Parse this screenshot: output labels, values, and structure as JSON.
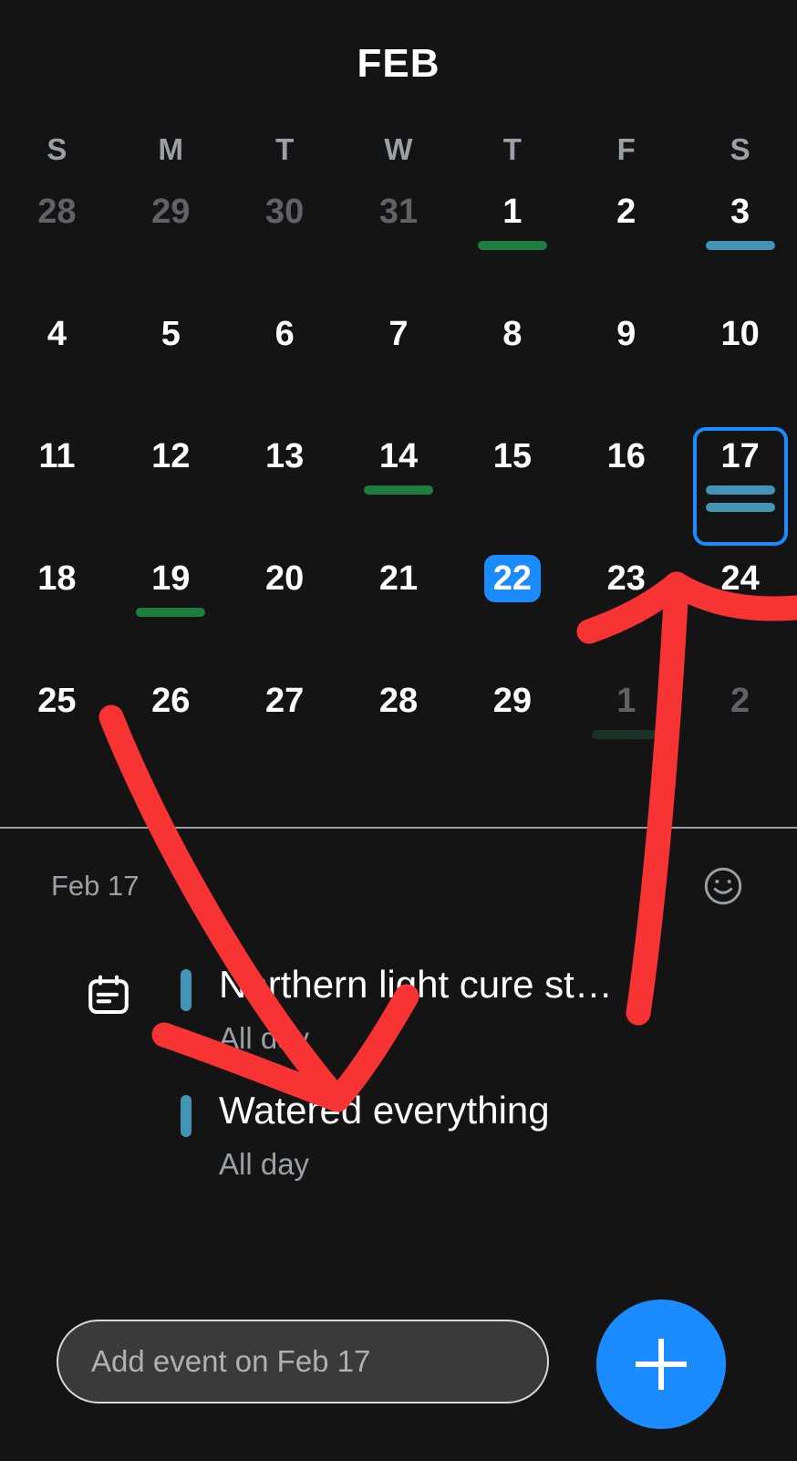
{
  "header": {
    "month_label": "FEB"
  },
  "weekdays": [
    "S",
    "M",
    "T",
    "W",
    "T",
    "F",
    "S"
  ],
  "calendar": {
    "weeks": [
      [
        {
          "num": "28",
          "other": true,
          "markers": []
        },
        {
          "num": "29",
          "other": true,
          "markers": []
        },
        {
          "num": "30",
          "other": true,
          "markers": []
        },
        {
          "num": "31",
          "other": true,
          "markers": []
        },
        {
          "num": "1",
          "other": false,
          "markers": [
            "green"
          ]
        },
        {
          "num": "2",
          "other": false,
          "markers": []
        },
        {
          "num": "3",
          "other": false,
          "markers": [
            "blue"
          ]
        }
      ],
      [
        {
          "num": "4",
          "other": false,
          "markers": []
        },
        {
          "num": "5",
          "other": false,
          "markers": []
        },
        {
          "num": "6",
          "other": false,
          "markers": []
        },
        {
          "num": "7",
          "other": false,
          "markers": []
        },
        {
          "num": "8",
          "other": false,
          "markers": []
        },
        {
          "num": "9",
          "other": false,
          "markers": []
        },
        {
          "num": "10",
          "other": false,
          "markers": []
        }
      ],
      [
        {
          "num": "11",
          "other": false,
          "markers": []
        },
        {
          "num": "12",
          "other": false,
          "markers": []
        },
        {
          "num": "13",
          "other": false,
          "markers": []
        },
        {
          "num": "14",
          "other": false,
          "markers": [
            "green"
          ]
        },
        {
          "num": "15",
          "other": false,
          "markers": []
        },
        {
          "num": "16",
          "other": false,
          "markers": []
        },
        {
          "num": "17",
          "other": false,
          "markers": [
            "blue",
            "blue"
          ],
          "selected": true
        }
      ],
      [
        {
          "num": "18",
          "other": false,
          "markers": []
        },
        {
          "num": "19",
          "other": false,
          "markers": [
            "green"
          ]
        },
        {
          "num": "20",
          "other": false,
          "markers": []
        },
        {
          "num": "21",
          "other": false,
          "markers": []
        },
        {
          "num": "22",
          "other": false,
          "markers": [],
          "today": true
        },
        {
          "num": "23",
          "other": false,
          "markers": []
        },
        {
          "num": "24",
          "other": false,
          "markers": []
        }
      ],
      [
        {
          "num": "25",
          "other": false,
          "markers": []
        },
        {
          "num": "26",
          "other": false,
          "markers": []
        },
        {
          "num": "27",
          "other": false,
          "markers": []
        },
        {
          "num": "28",
          "other": false,
          "markers": []
        },
        {
          "num": "29",
          "other": false,
          "markers": []
        },
        {
          "num": "1",
          "other": true,
          "markers": [
            "dim"
          ]
        },
        {
          "num": "2",
          "other": true,
          "markers": []
        }
      ]
    ]
  },
  "event_pane": {
    "date_label": "Feb 17",
    "mood_icon": "smiley-icon",
    "events": [
      {
        "title": "Northern light cure st…",
        "subtitle": "All day",
        "color": "#4394b5",
        "has_calendar_icon": true
      },
      {
        "title": "Watered everything",
        "subtitle": "All day",
        "color": "#4394b5",
        "has_calendar_icon": false
      }
    ]
  },
  "bottom_bar": {
    "add_event_placeholder": "Add event on Feb 17",
    "fab_label": "+"
  },
  "colors": {
    "background": "#141414",
    "accent_blue": "#1a8cff",
    "event_green": "#1e7e40",
    "event_blue": "#4394b5",
    "annotation_red": "#f83333",
    "muted_text": "#9aa0a6"
  }
}
